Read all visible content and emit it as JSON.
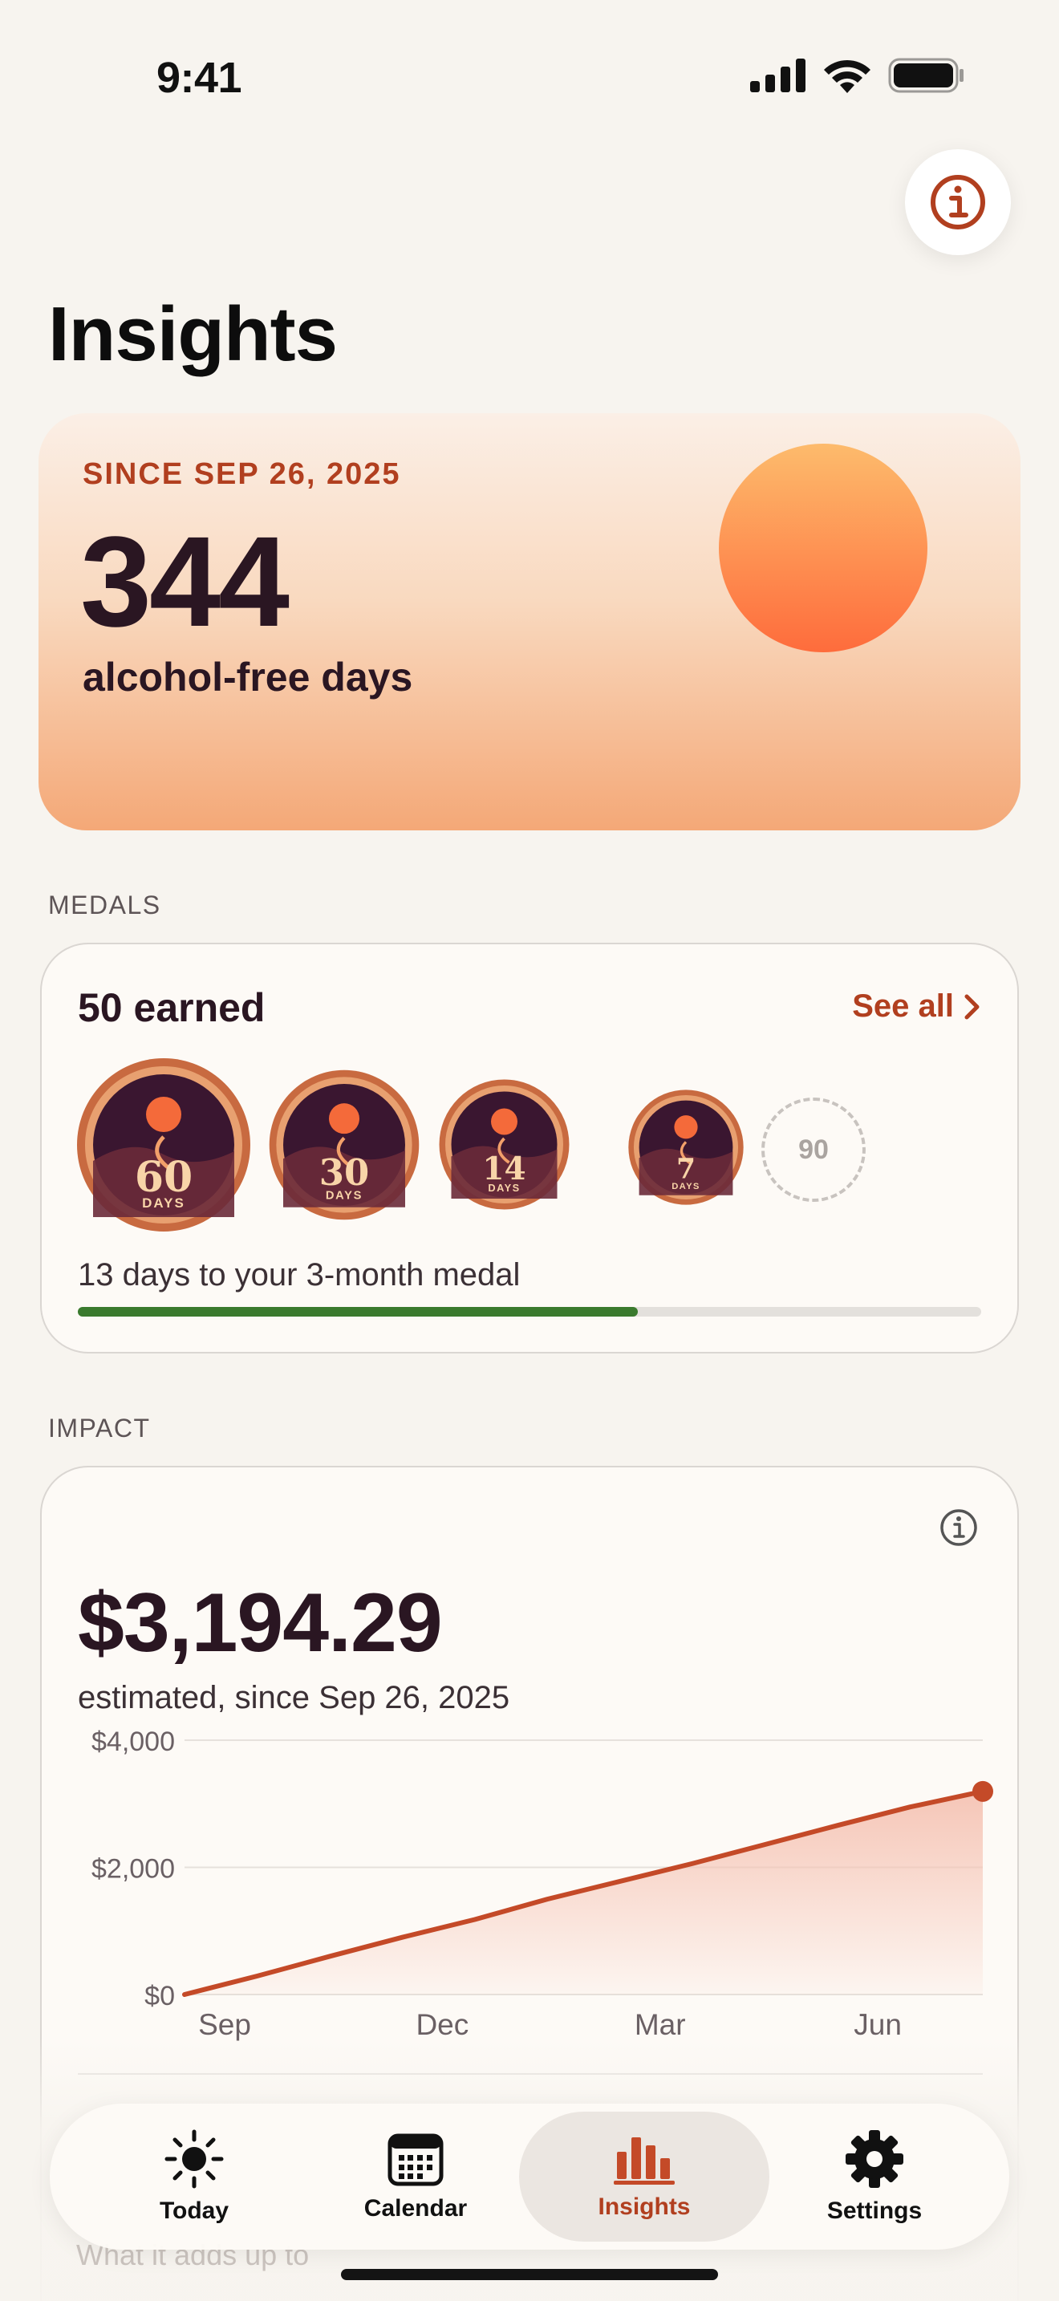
{
  "status_bar": {
    "time": "9:41"
  },
  "page": {
    "title": "Insights"
  },
  "hero": {
    "since": "SINCE SEP 26, 2025",
    "count": "344",
    "label": "alcohol-free days"
  },
  "medals": {
    "section_label": "MEDALS",
    "earned": "50 earned",
    "see_all": "See all",
    "items": [
      {
        "number": "60",
        "unit": "DAYS"
      },
      {
        "number": "30",
        "unit": "DAYS"
      },
      {
        "number": "14",
        "unit": "DAYS"
      },
      {
        "number": "7",
        "unit": "DAYS"
      }
    ],
    "next_medal": "90",
    "progress_text": "13 days to your 3-month medal",
    "progress_fraction": 0.62
  },
  "impact": {
    "section_label": "IMPACT",
    "amount": "$3,194.29",
    "subtitle": "estimated, since Sep 26, 2025",
    "faded_row": "What it adds up to"
  },
  "chart_data": {
    "type": "area",
    "x": [
      "Sep",
      "Oct",
      "Nov",
      "Dec",
      "Jan",
      "Feb",
      "Mar",
      "Apr",
      "May",
      "Jun",
      "Jul",
      "Aug"
    ],
    "x_tick_labels": [
      "Sep",
      "Dec",
      "Mar",
      "Jun"
    ],
    "y_tick_labels": [
      "$4,000",
      "$2,000",
      "$0"
    ],
    "ylim": [
      0,
      4000
    ],
    "series": [
      {
        "values": [
          0,
          290,
          600,
          900,
          1180,
          1500,
          1780,
          2060,
          2360,
          2660,
          2950,
          3194.29
        ]
      }
    ],
    "grid": true,
    "line_color": "#c44a28",
    "fill_color": "#f5c0b0"
  },
  "tab_bar": {
    "tabs": [
      {
        "label": "Today",
        "icon": "sun-icon"
      },
      {
        "label": "Calendar",
        "icon": "calendar-icon"
      },
      {
        "label": "Insights",
        "icon": "bar-chart-icon"
      },
      {
        "label": "Settings",
        "icon": "gear-icon"
      }
    ],
    "active": "Insights"
  },
  "colors": {
    "accent": "#b13f1f",
    "progress": "#3a7a2e",
    "text": "#2a1622",
    "background": "#f7f4ef"
  }
}
